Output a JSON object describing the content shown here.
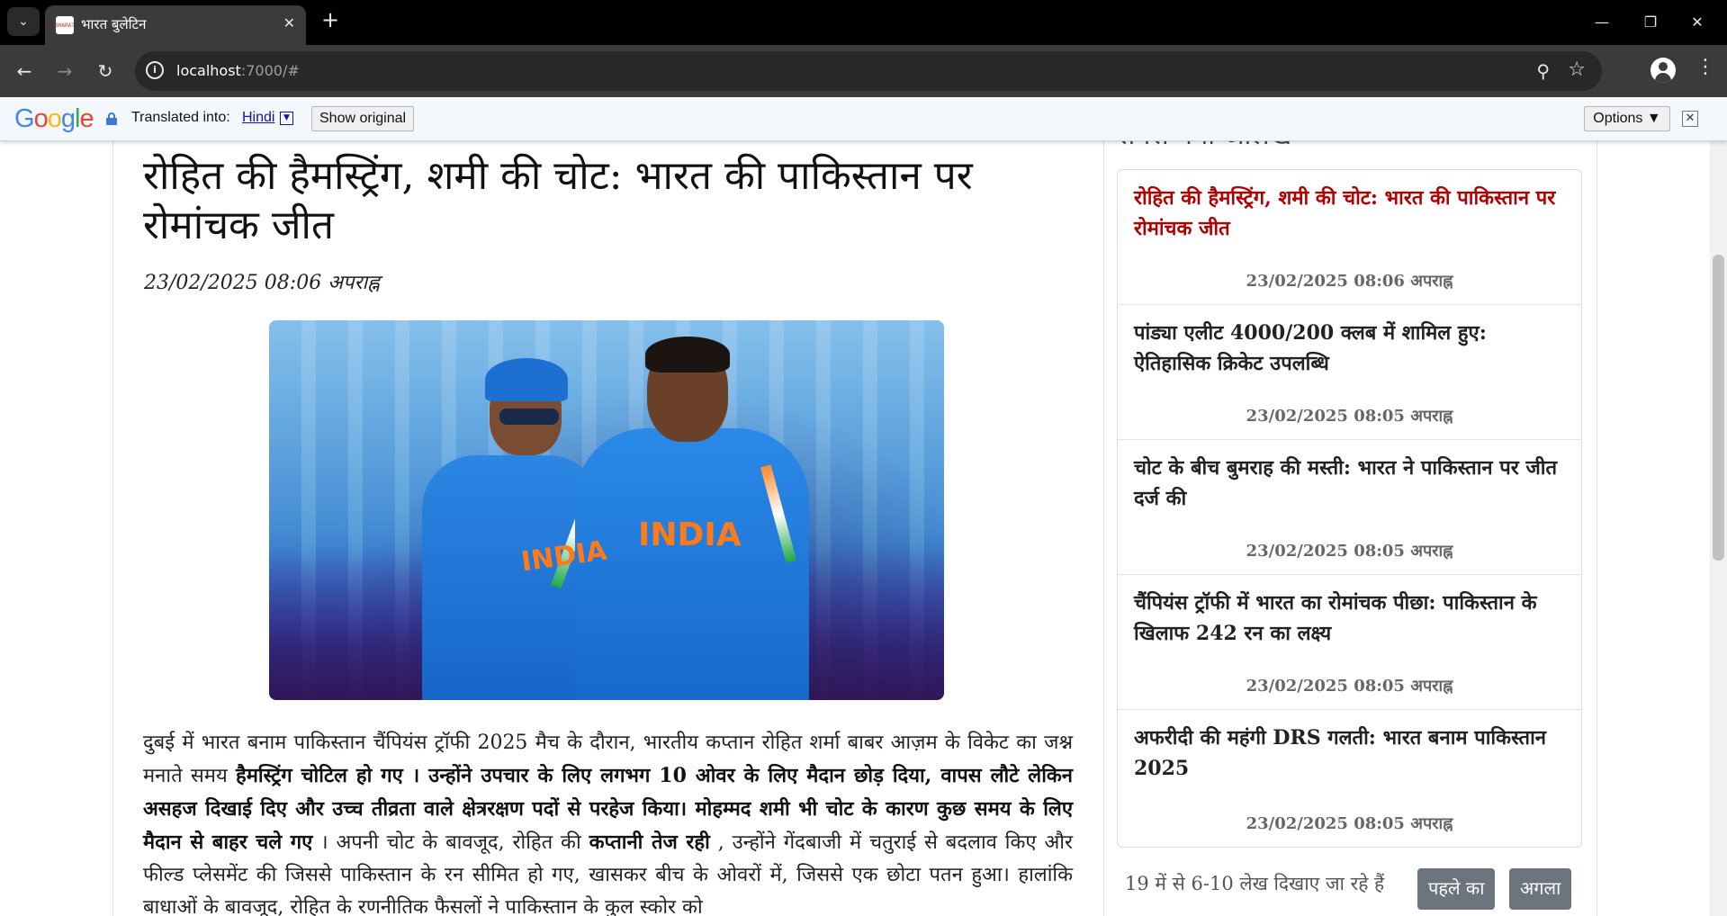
{
  "browser": {
    "tab_title": "भारत बुलेटिन",
    "tab_favicon_text": "BHARAT",
    "url_host": "localhost",
    "url_path": ":7000/#"
  },
  "translate_bar": {
    "logo": "Google",
    "translated_label": "Translated into:",
    "language": "Hindi",
    "show_original": "Show original",
    "options": "Options ▼"
  },
  "article": {
    "title": "रोहित की हैमस्ट्रिंग, शमी की चोट: भारत की पाकिस्तान पर रोमांचक जीत",
    "date": "23/02/2025 08:06 अपराह्न",
    "body": [
      {
        "text": "दुबई में भारत बनाम पाकिस्तान चैंपियंस ट्रॉफी 2025 मैच के दौरान, भारतीय कप्तान रोहित शर्मा बाबर आज़म के विकेट का जश्न मनाते समय ",
        "bold": false
      },
      {
        "text": "हैमस्ट्रिंग चोटिल हो गए । उन्होंने उपचार के लिए लगभग 10 ओवर के लिए मैदान छोड़ दिया, वापस लौटे लेकिन असहज दिखाई दिए और उच्च तीव्रता वाले क्षेत्ररक्षण पदों से परहेज किया। मोहम्मद शमी भी चोट के कारण कुछ समय के लिए मैदान से बाहर चले गए",
        "bold": true
      },
      {
        "text": " । अपनी चोट के बावजूद, रोहित की ",
        "bold": false
      },
      {
        "text": "कप्तानी तेज रही",
        "bold": true
      },
      {
        "text": " , उन्होंने गेंदबाजी में चतुराई से बदलाव किए और फील्ड प्लेसमेंट की जिससे पाकिस्तान के रन सीमित हो गए, खासकर बीच के ओवरों में, जिससे एक छोटा पतन हुआ। हालांकि बाधाओं के बावजूद, रोहित के रणनीतिक फैसलों ने पाकिस्तान के कुल स्कोर को",
        "bold": false
      }
    ]
  },
  "sidebar": {
    "heading": "सबसे नया आलेख",
    "items": [
      {
        "title": "रोहित की हैमस्ट्रिंग, शमी की चोट: भारत की पाकिस्तान पर रोमांचक जीत",
        "date": "23/02/2025 08:06 अपराह्न",
        "active": true
      },
      {
        "title": "पांड्या एलीट 4000/200 क्लब में शामिल हुए: ऐतिहासिक क्रिकेट उपलब्धि",
        "date": "23/02/2025 08:05 अपराह्न",
        "active": false
      },
      {
        "title": "चोट के बीच बुमराह की मस्ती: भारत ने पाकिस्तान पर जीत दर्ज की",
        "date": "23/02/2025 08:05 अपराह्न",
        "active": false
      },
      {
        "title": "चैंपियंस ट्रॉफी में भारत का रोमांचक पीछा: पाकिस्तान के खिलाफ 242 रन का लक्ष्य",
        "date": "23/02/2025 08:05 अपराह्न",
        "active": false
      },
      {
        "title": "अफरीदी की महंगी DRS गलती: भारत बनाम पाकिस्तान 2025",
        "date": "23/02/2025 08:05 अपराह्न",
        "active": false
      }
    ],
    "pagination_info": "19 में से 6-10 लेख दिखाए जा रहे हैं",
    "prev_label": "पहले का",
    "next_label": "अगला"
  },
  "icons": {
    "tab_list": "chevron-down-icon",
    "back": "arrow-left-icon",
    "forward": "arrow-right-icon",
    "reload": "reload-icon",
    "site_info": "info-icon",
    "location": "location-pin-icon",
    "bookmark": "star-icon",
    "profile": "profile-icon",
    "menu": "kebab-menu-icon"
  },
  "colors": {
    "active_link": "#b00000",
    "page_button": "#6c757d",
    "chrome_dark": "#3b3b3b"
  }
}
